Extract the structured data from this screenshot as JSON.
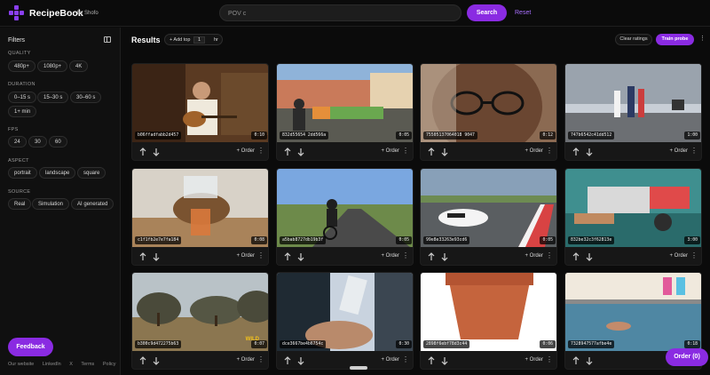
{
  "app": {
    "brand": "RecipeBook",
    "brand_by": "by Shofo",
    "accent": "#8a2be2"
  },
  "search": {
    "value": "POV c",
    "button": "Search",
    "reset": "Reset"
  },
  "sidebar": {
    "title": "Filters",
    "sections": [
      {
        "label": "QUALITY",
        "options": [
          "480p+",
          "1080p+",
          "4K"
        ]
      },
      {
        "label": "DURATION",
        "options": [
          "0–15 s",
          "15–30 s",
          "30–60 s",
          "1+ min"
        ]
      },
      {
        "label": "FPS",
        "options": [
          "24",
          "30",
          "60"
        ]
      },
      {
        "label": "ASPECT",
        "options": [
          "portrait",
          "landscape",
          "square"
        ]
      },
      {
        "label": "SOURCE",
        "options": [
          "Real",
          "Simulation",
          "AI generated"
        ]
      }
    ],
    "feedback": "Feedback",
    "footer_links": [
      "Our website",
      "LinkedIn",
      "X",
      "Terms",
      "Policy"
    ]
  },
  "results": {
    "title": "Results",
    "add_top_label": "+ Add top",
    "add_top_value": "1",
    "add_top_unit": "hr",
    "clear_ratings": "Clear ratings",
    "train_probe": "Train probe",
    "more": "⋮"
  },
  "card_actions": {
    "order": "+ Order",
    "menu": "⋮"
  },
  "cards": [
    {
      "id": "b06ffadfabb2d457",
      "duration": "0:10",
      "scene": "guitar"
    },
    {
      "id": "832d55654 2dd566a",
      "duration": "0:05",
      "scene": "market"
    },
    {
      "id": "75505137064018 9047",
      "duration": "0:12",
      "scene": "face"
    },
    {
      "id": "747b6542c41dd512",
      "duration": "1:00",
      "scene": "runners"
    },
    {
      "id": "c1f1fb2e7e7fa184",
      "duration": "0:08",
      "scene": "dispenser"
    },
    {
      "id": "a5bab8727db19b3f",
      "duration": "0:05",
      "scene": "cyclist"
    },
    {
      "id": "99e8e33263e93cd6",
      "duration": "0:05",
      "scene": "racecar"
    },
    {
      "id": "832be32c3f62813e",
      "duration": "3:00",
      "scene": "workbench"
    },
    {
      "id": "b300c9d472275b63",
      "duration": "0:07",
      "scene": "savanna",
      "logo": "WILD"
    },
    {
      "id": "dce3667be4b6754c",
      "duration": "0:30",
      "scene": "bottle"
    },
    {
      "id": "2898f6ebf78d3c44",
      "duration": "0:06",
      "scene": "pot"
    },
    {
      "id": "7328947577afbe4e",
      "duration": "0:18",
      "scene": "pool"
    }
  ],
  "order_float": "Order (0)"
}
